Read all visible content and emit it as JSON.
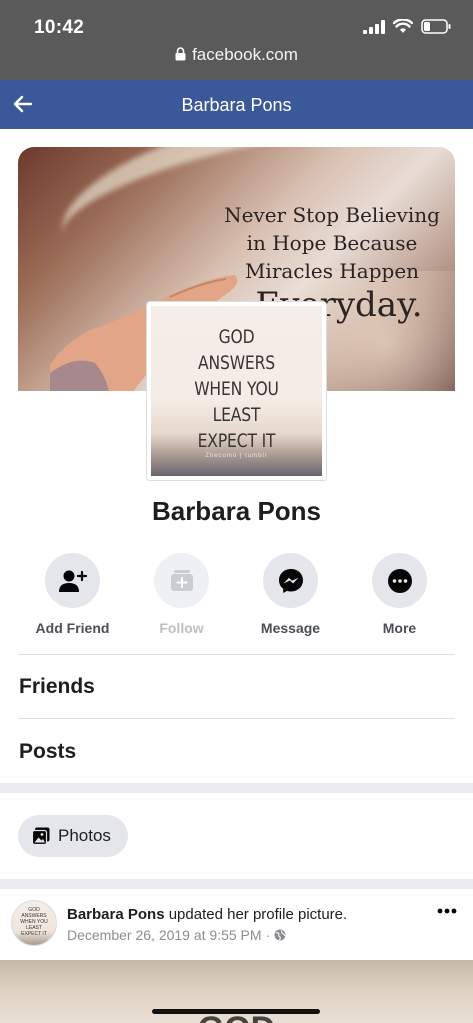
{
  "status_bar": {
    "time": "10:42",
    "url": "facebook.com"
  },
  "header": {
    "title": "Barbara Pons"
  },
  "cover": {
    "quote_lines": [
      "Never Stop Believing",
      "in Hope Because",
      "Miracles Happen",
      "Everyday."
    ]
  },
  "profile_picture": {
    "lines": [
      "GOD",
      "ANSWERS",
      "WHEN YOU",
      "LEAST",
      "EXPECT IT"
    ],
    "credit": "Zhecomo | tumblr"
  },
  "profile": {
    "name": "Barbara Pons"
  },
  "actions": [
    {
      "label": "Add Friend",
      "icon": "add-friend-icon",
      "enabled": true
    },
    {
      "label": "Follow",
      "icon": "follow-icon",
      "enabled": false
    },
    {
      "label": "Message",
      "icon": "messenger-icon",
      "enabled": true
    },
    {
      "label": "More",
      "icon": "more-icon",
      "enabled": true
    }
  ],
  "sections": {
    "friends": "Friends",
    "posts": "Posts"
  },
  "photos_button": {
    "label": "Photos"
  },
  "post": {
    "author": "Barbara Pons",
    "action": "updated her profile picture.",
    "date": "December 26, 2019 at 9:55 PM",
    "separator": "·",
    "image_peek": "GOD"
  },
  "colors": {
    "fb_blue": "#3b5998",
    "status_gray": "#5a5a5a",
    "button_gray": "#e4e6eb",
    "section_band": "#e9ebee"
  }
}
